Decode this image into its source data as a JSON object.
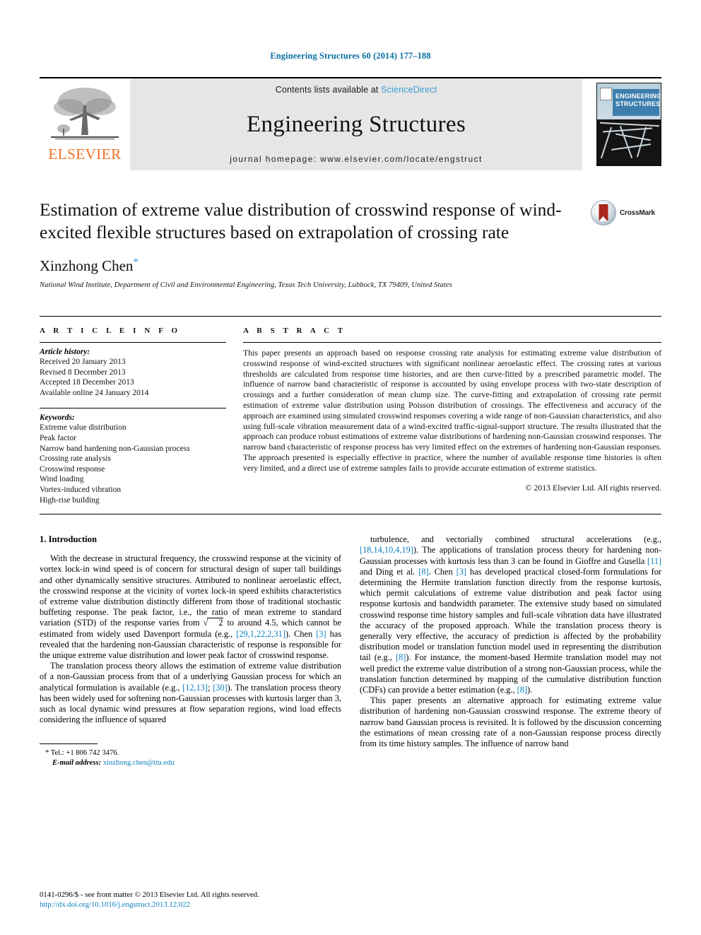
{
  "header": {
    "citation": "Engineering Structures 60 (2014) 177–188",
    "contents_prefix": "Contents lists available at ",
    "contents_link": "ScienceDirect",
    "journal_title": "Engineering Structures",
    "homepage": "journal homepage: www.elsevier.com/locate/engstruct",
    "publisher_logo_text": "ELSEVIER",
    "cover_band_text": "Engineering Structures"
  },
  "title_block": {
    "title": "Estimation of extreme value distribution of crosswind response of wind-excited flexible structures based on extrapolation of crossing rate",
    "author": "Xinzhong Chen",
    "author_marker": "*",
    "affiliation": "National Wind Institute, Department of Civil and Environmental Engineering, Texas Tech University, Lubbock, TX 79409, United States",
    "crossmark_label": "CrossMark"
  },
  "article_info": {
    "heading": "A R T I C L E    I N F O",
    "history_label": "Article history:",
    "history": [
      "Received 20 January 2013",
      "Revised 8 December 2013",
      "Accepted 18 December 2013",
      "Available online 24 January 2014"
    ],
    "keywords_label": "Keywords:",
    "keywords": [
      "Extreme value distribution",
      "Peak factor",
      "Narrow band hardening non-Gaussian process",
      "Crossing rate analysis",
      "Crosswind response",
      "Wind loading",
      "Vortex-induced vibration",
      "High-rise building"
    ]
  },
  "abstract": {
    "heading": "A B S T R A C T",
    "text": "This paper presents an approach based on response crossing rate analysis for estimating extreme value distribution of crosswind response of wind-excited structures with significant nonlinear aeroelastic effect. The crossing rates at various thresholds are calculated from response time histories, and are then curve-fitted by a prescribed parametric model. The influence of narrow band characteristic of response is accounted by using envelope process with two-state description of crossings and a further consideration of mean clump size. The curve-fitting and extrapolation of crossing rate permit estimation of extreme value distribution using Poisson distribution of crossings. The effectiveness and accuracy of the approach are examined using simulated crosswind responses covering a wide range of non-Gaussian characteristics, and also using full-scale vibration measurement data of a wind-excited traffic-signal-support structure. The results illustrated that the approach can produce robust estimations of extreme value distributions of hardening non-Gaussian crosswind responses. The narrow band characteristic of response process has very limited effect on the extremes of hardening non-Gaussian responses. The approach presented is especially effective in practice, where the number of available response time histories is often very limited, and a direct use of extreme samples fails to provide accurate estimation of extreme statistics.",
    "copyright": "© 2013 Elsevier Ltd. All rights reserved."
  },
  "body": {
    "section_title": "1. Introduction",
    "left_paragraphs": [
      {
        "parts": [
          {
            "t": "With the decrease in structural frequency, the crosswind response at the vicinity of vortex lock-in wind speed is of concern for structural design of super tall buildings and other dynamically sensitive structures. Attributed to nonlinear aeroelastic effect, the crosswind response at the vicinity of vortex lock-in speed exhibits characteristics of extreme value distribution distinctly different from those of traditional stochastic buffeting response. The peak factor, i.e., the ratio of mean extreme to standard variation (STD) of the response varies from "
          },
          {
            "t": "√2",
            "sqrt": true
          },
          {
            "t": " to around 4.5, which cannot be estimated from widely used Davenport formula (e.g., "
          },
          {
            "t": "[29,1,22,2,31]",
            "ref": true
          },
          {
            "t": "). Chen "
          },
          {
            "t": "[3]",
            "ref": true
          },
          {
            "t": " has revealed that the hardening non-Gaussian characteristic of response is responsible for the unique extreme value distribution and lower peak factor of crosswind response."
          }
        ]
      },
      {
        "parts": [
          {
            "t": "The translation process theory allows the estimation of extreme value distribution of a non-Gaussian process from that of a underlying Gaussian process for which an analytical formulation is available (e.g., "
          },
          {
            "t": "[12,13]",
            "ref": true
          },
          {
            "t": "; "
          },
          {
            "t": "[30]",
            "ref": true
          },
          {
            "t": "). The translation process theory has been widely used for softening non-Gaussian processes with kurtosis larger than 3, such as local dynamic wind pressures at flow separation regions, wind load effects considering the influence of squared"
          }
        ]
      }
    ],
    "right_paragraphs": [
      {
        "parts": [
          {
            "t": "turbulence, and vectorially combined structural accelerations (e.g., "
          },
          {
            "t": "[18,14,10,4,19]",
            "ref": true
          },
          {
            "t": "). The applications of translation process theory for hardening non-Gaussian processes with kurtosis less than 3 can be found in Gioffre and Gusella "
          },
          {
            "t": "[11]",
            "ref": true
          },
          {
            "t": " and Ding et al. "
          },
          {
            "t": "[8]",
            "ref": true
          },
          {
            "t": ". Chen "
          },
          {
            "t": "[3]",
            "ref": true
          },
          {
            "t": " has developed practical closed-form formulations for determining the Hermite translation function directly from the response kurtosis, which permit calculations of extreme value distribution and peak factor using response kurtosis and bandwidth parameter. The extensive study based on simulated crosswind response time history samples and full-scale vibration data have illustrated the accuracy of the proposed approach. While the translation process theory is generally very effective, the accuracy of prediction is affected by the probability distribution model or translation function model used in representing the distribution tail (e.g., "
          },
          {
            "t": "[8]",
            "ref": true
          },
          {
            "t": "). For instance, the moment-based Hermite translation model may not well predict the extreme value distribution of a strong non-Gaussian process, while the translation function determined by mapping of the cumulative distribution function (CDFs) can provide a better estimation (e.g., "
          },
          {
            "t": "[8]",
            "ref": true
          },
          {
            "t": ")."
          }
        ]
      },
      {
        "parts": [
          {
            "t": "This paper presents an alternative approach for estimating extreme value distribution of hardening non-Gaussian crosswind response. The extreme theory of narrow band Gaussian process is revisited. It is followed by the discussion concerning the estimations of mean crossing rate of a non-Gaussian response process directly from its time history samples. The influence of narrow band"
          }
        ]
      }
    ]
  },
  "footnote": {
    "marker": "*",
    "tel": "Tel.: +1 806 742 3476.",
    "email_label": "E-mail address:",
    "email": "xinzhong.chen@ttu.edu"
  },
  "footer": {
    "issn_line": "0141-0296/$ - see front matter © 2013 Elsevier Ltd. All rights reserved.",
    "doi": "http://dx.doi.org/10.1016/j.engstruct.2013.12.022"
  },
  "colors": {
    "link": "#0b7fc0",
    "citation": "#0b6fa4",
    "elsevier_orange": "#F36D21",
    "cover_blue": "#3d7ead",
    "sciencedirect": "#3a9bd5"
  }
}
